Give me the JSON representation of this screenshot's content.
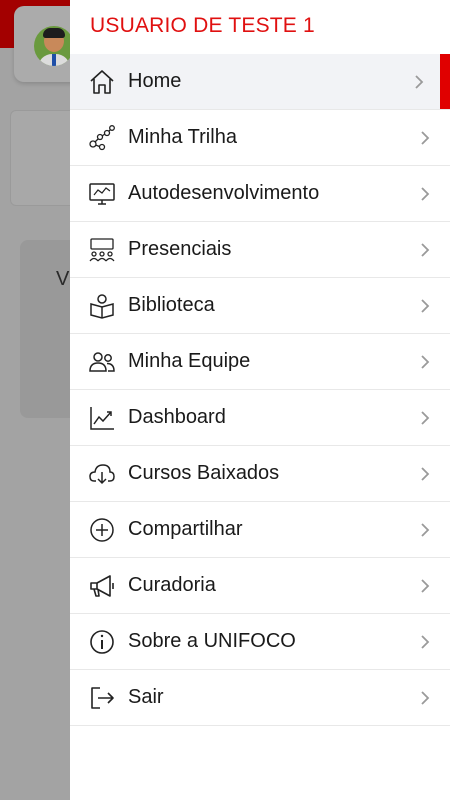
{
  "background": {
    "partial_text": "V"
  },
  "drawer": {
    "user_name": "USUARIO DE TESTE 1",
    "menu": [
      {
        "label": "Home",
        "icon": "home-icon",
        "active": true
      },
      {
        "label": "Minha Trilha",
        "icon": "trail-network-icon",
        "active": false
      },
      {
        "label": "Autodesenvolvimento",
        "icon": "monitor-chart-icon",
        "active": false
      },
      {
        "label": "Presenciais",
        "icon": "classroom-icon",
        "active": false
      },
      {
        "label": "Biblioteca",
        "icon": "reader-book-icon",
        "active": false
      },
      {
        "label": "Minha Equipe",
        "icon": "team-icon",
        "active": false
      },
      {
        "label": "Dashboard",
        "icon": "trend-chart-icon",
        "active": false
      },
      {
        "label": "Cursos Baixados",
        "icon": "cloud-download-icon",
        "active": false
      },
      {
        "label": "Compartilhar",
        "icon": "plus-circle-icon",
        "active": false
      },
      {
        "label": "Curadoria",
        "icon": "megaphone-icon",
        "active": false
      },
      {
        "label": "Sobre a UNIFOCO",
        "icon": "info-icon",
        "active": false
      },
      {
        "label": "Sair",
        "icon": "logout-icon",
        "active": false
      }
    ]
  },
  "colors": {
    "accent": "#e00000",
    "user_name": "#e01010",
    "active_row": "#f2f3f6"
  }
}
